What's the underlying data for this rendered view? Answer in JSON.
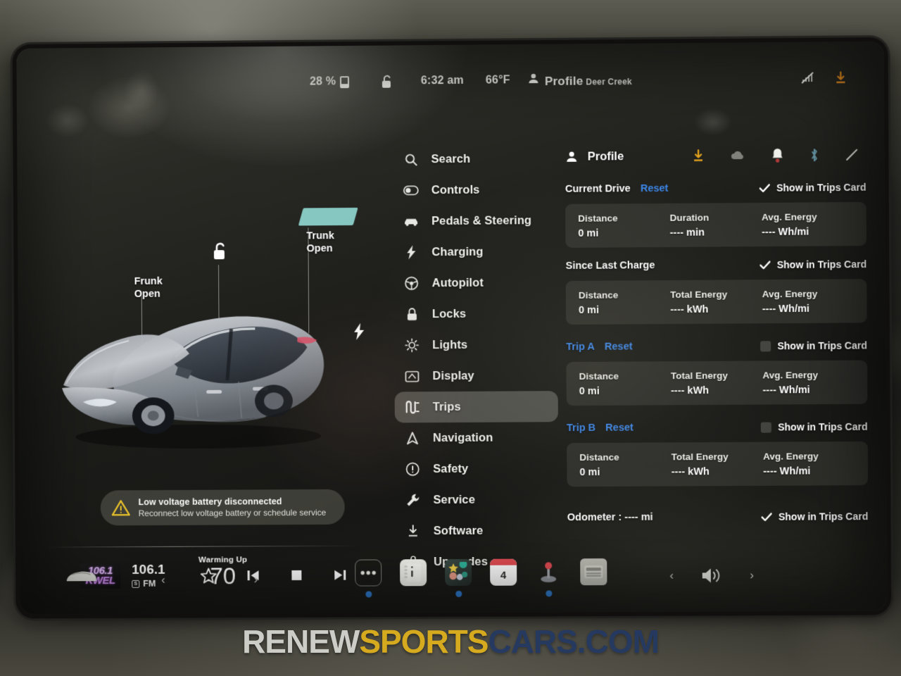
{
  "status_bar": {
    "battery_percent": "28 %",
    "lock_icon": "unlocked-padlock-icon",
    "time": "6:32 am",
    "temperature": "66°F",
    "profile_label": "Profile",
    "profile_name": "Deer Creek",
    "right_icons": [
      "no-signal-icon",
      "software-download-icon"
    ]
  },
  "car_view": {
    "frunk_label": "Frunk\nOpen",
    "frunk_label_line1": "Frunk",
    "frunk_label_line2": "Open",
    "trunk_label_line1": "Trunk",
    "trunk_label_line2": "Open",
    "lock_state_icon": "unlocked-padlock-icon",
    "charge_port_icon": "charge-bolt-icon",
    "car_color": "#b9bcc0"
  },
  "alert": {
    "title": "Low voltage battery disconnected",
    "subtitle": "Reconnect low voltage battery or schedule service",
    "icon": "warning-triangle-icon",
    "icon_color": "#e8c22a"
  },
  "media": {
    "logo_line1": "106.1",
    "logo_line2": "KWEL",
    "frequency": "106.1",
    "band_chip": "S",
    "band": "FM",
    "controls": [
      "favorite-star-icon",
      "previous-track-icon",
      "stop-icon",
      "next-track-icon"
    ]
  },
  "menu": {
    "items": [
      {
        "label": "Search",
        "icon": "search-icon",
        "active": false
      },
      {
        "label": "Controls",
        "icon": "toggle-icon",
        "active": false
      },
      {
        "label": "Pedals & Steering",
        "icon": "car-front-icon",
        "active": false
      },
      {
        "label": "Charging",
        "icon": "bolt-icon",
        "active": false
      },
      {
        "label": "Autopilot",
        "icon": "steering-icon",
        "active": false
      },
      {
        "label": "Locks",
        "icon": "lock-icon",
        "active": false
      },
      {
        "label": "Lights",
        "icon": "sun-icon",
        "active": false
      },
      {
        "label": "Display",
        "icon": "display-icon",
        "active": false
      },
      {
        "label": "Trips",
        "icon": "trips-icon",
        "active": true
      },
      {
        "label": "Navigation",
        "icon": "navigation-icon",
        "active": false
      },
      {
        "label": "Safety",
        "icon": "alert-circle-icon",
        "active": false
      },
      {
        "label": "Service",
        "icon": "wrench-icon",
        "active": false
      },
      {
        "label": "Software",
        "icon": "download-icon",
        "active": false
      },
      {
        "label": "Upgrades",
        "icon": "bag-icon",
        "active": false
      }
    ]
  },
  "trips": {
    "panel_title": "Profile",
    "panel_icons": [
      "software-download-icon",
      "cloud-icon",
      "notification-bell-icon",
      "bluetooth-icon",
      "no-signal-icon"
    ],
    "show_in_trips_card_label": "Show in Trips Card",
    "reset_label": "Reset",
    "sections": [
      {
        "title": "Current Drive",
        "title_is_link": false,
        "has_reset": true,
        "checked": true,
        "stats": [
          {
            "key": "Distance",
            "value": "0 mi"
          },
          {
            "key": "Duration",
            "value": "---- min"
          },
          {
            "key": "Avg. Energy",
            "value": "---- Wh/mi"
          }
        ]
      },
      {
        "title": "Since Last Charge",
        "title_is_link": false,
        "has_reset": false,
        "checked": true,
        "stats": [
          {
            "key": "Distance",
            "value": "0 mi"
          },
          {
            "key": "Total Energy",
            "value": "---- kWh"
          },
          {
            "key": "Avg. Energy",
            "value": "---- Wh/mi"
          }
        ]
      },
      {
        "title": "Trip A",
        "title_is_link": true,
        "has_reset": true,
        "checked": false,
        "stats": [
          {
            "key": "Distance",
            "value": "0 mi"
          },
          {
            "key": "Total Energy",
            "value": "---- kWh"
          },
          {
            "key": "Avg. Energy",
            "value": "---- Wh/mi"
          }
        ]
      },
      {
        "title": "Trip B",
        "title_is_link": true,
        "has_reset": true,
        "checked": false,
        "stats": [
          {
            "key": "Distance",
            "value": "0 mi"
          },
          {
            "key": "Total Energy",
            "value": "---- kWh"
          },
          {
            "key": "Avg. Energy",
            "value": "---- Wh/mi"
          }
        ]
      }
    ],
    "odometer": {
      "label": "Odometer :  ---- mi",
      "checked": true
    }
  },
  "dock": {
    "climate_state": "Warming Up",
    "climate_temp": "70",
    "left_arrow": "‹",
    "right_arrow": "›",
    "apps": [
      {
        "name": "more-apps-icon",
        "dot": true
      },
      {
        "name": "release-notes-icon",
        "dot": false
      },
      {
        "name": "toybox-icon",
        "dot": true
      },
      {
        "name": "calendar-icon",
        "dot": false,
        "day": "4"
      },
      {
        "name": "arcade-joystick-icon",
        "dot": true
      },
      {
        "name": "keyboard-icon",
        "dot": false
      }
    ],
    "volume_icon": "speaker-icon"
  },
  "watermark": {
    "part1": "RENEW",
    "part2": "SPORTS",
    "part3": "CARS.COM"
  },
  "colors": {
    "accent_blue": "#3b86e8",
    "warning_yellow": "#e8c22a",
    "download_orange": "#e08a1e",
    "trunk_highlight": "#8fd6cf"
  }
}
